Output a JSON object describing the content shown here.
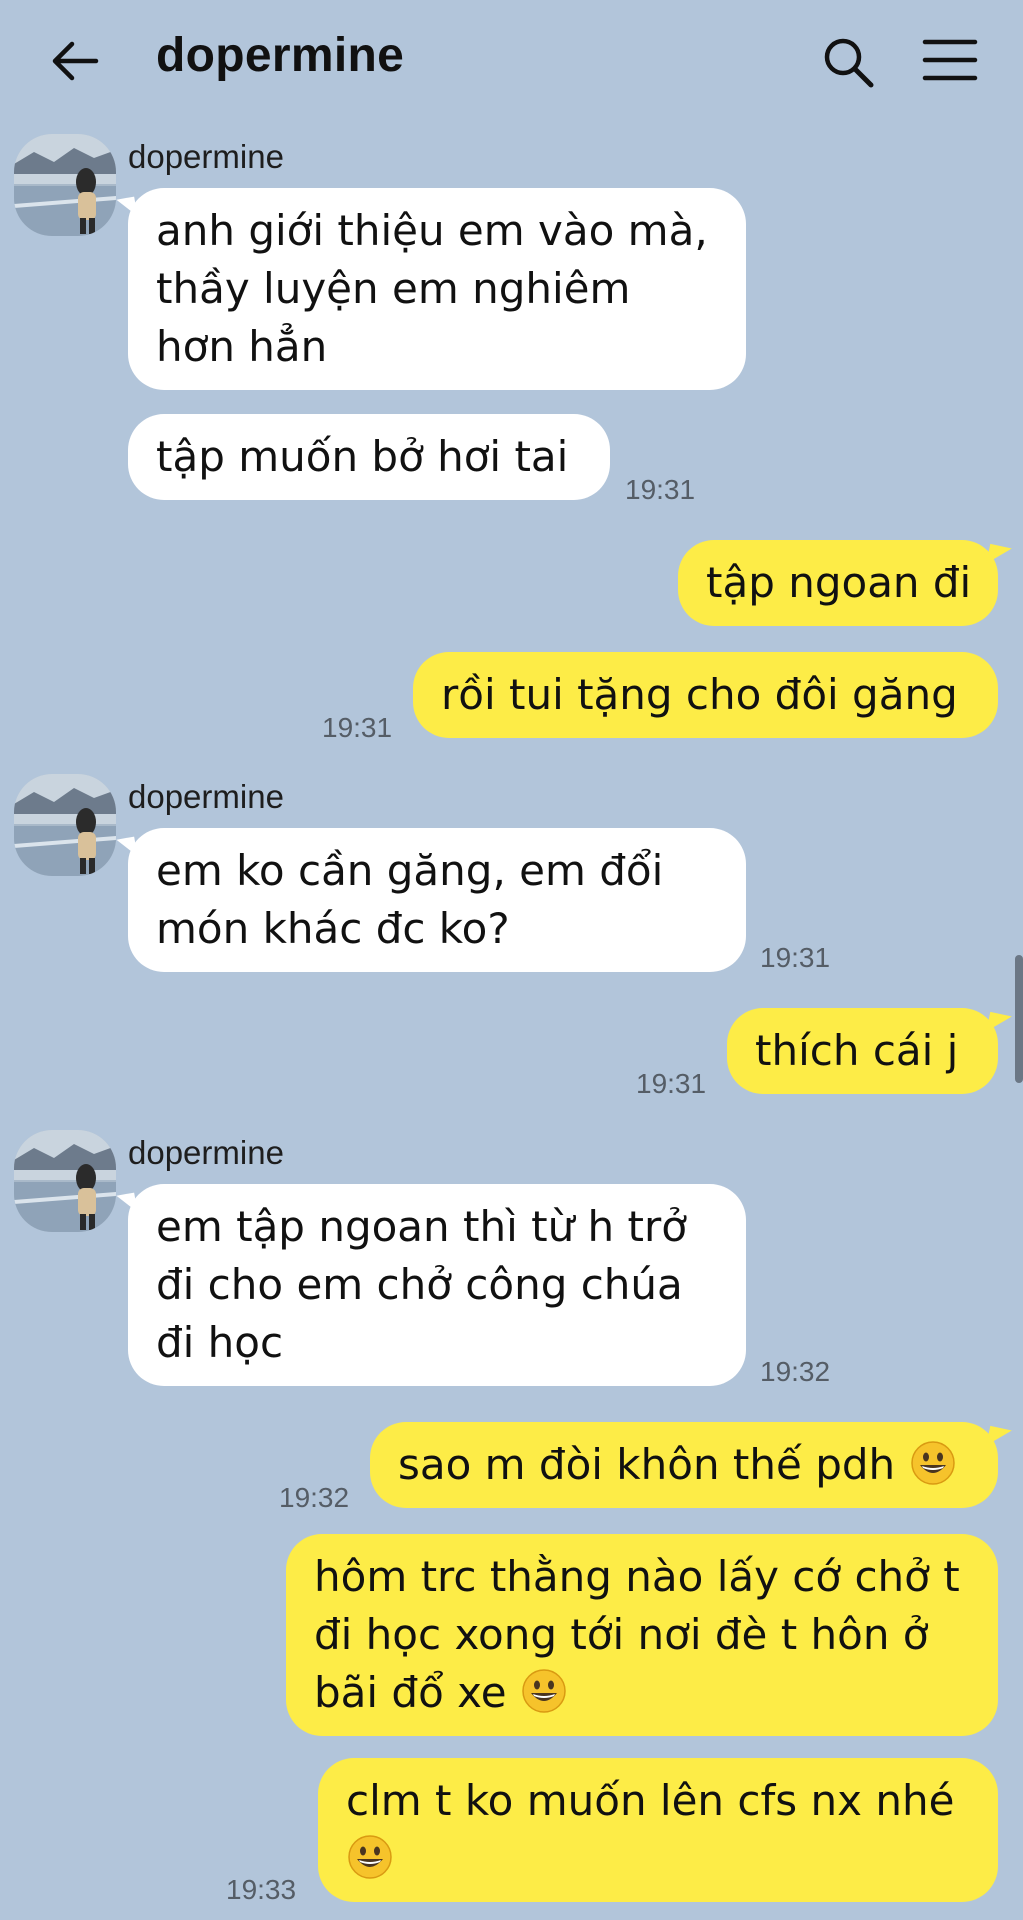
{
  "header": {
    "title": "dopermine",
    "back_icon": "back-arrow-icon",
    "search_icon": "search-icon",
    "menu_icon": "hamburger-menu-icon"
  },
  "messages": [
    {
      "side": "in",
      "sender": "dopermine",
      "text": "anh giới thiệu em vào mà, thầy luyện em nghiêm hơn hẳn"
    },
    {
      "side": "in",
      "text": "tập muốn bở hơi tai",
      "time": "19:31"
    },
    {
      "side": "out",
      "text": "tập ngoan đi"
    },
    {
      "side": "out",
      "text": "rồi tui tặng cho đôi găng",
      "time": "19:31"
    },
    {
      "side": "in",
      "sender": "dopermine",
      "text": "em ko cần găng, em đổi món khác đc ko?",
      "time": "19:31"
    },
    {
      "side": "out",
      "text": "thích cái j",
      "time": "19:31"
    },
    {
      "side": "in",
      "sender": "dopermine",
      "text": "em tập ngoan thì từ h trở đi cho em chở công chúa đi học",
      "time": "19:32"
    },
    {
      "side": "out",
      "text": "sao m đòi khôn thế pdh",
      "emoji": "grinning-face",
      "time": "19:32"
    },
    {
      "side": "out",
      "text": "hôm trc thằng nào lấy cớ chở t đi học xong tới nơi đè t hôn ở bãi đổ xe",
      "emoji": "grinning-face"
    },
    {
      "side": "out",
      "text": "clm t ko muốn lên cfs nx nhé",
      "emoji": "grinning-face",
      "time": "19:33"
    }
  ],
  "colors": {
    "background": "#b2c5da",
    "incoming_bubble": "#ffffff",
    "outgoing_bubble": "#fdec47",
    "timestamp": "#555d66"
  }
}
